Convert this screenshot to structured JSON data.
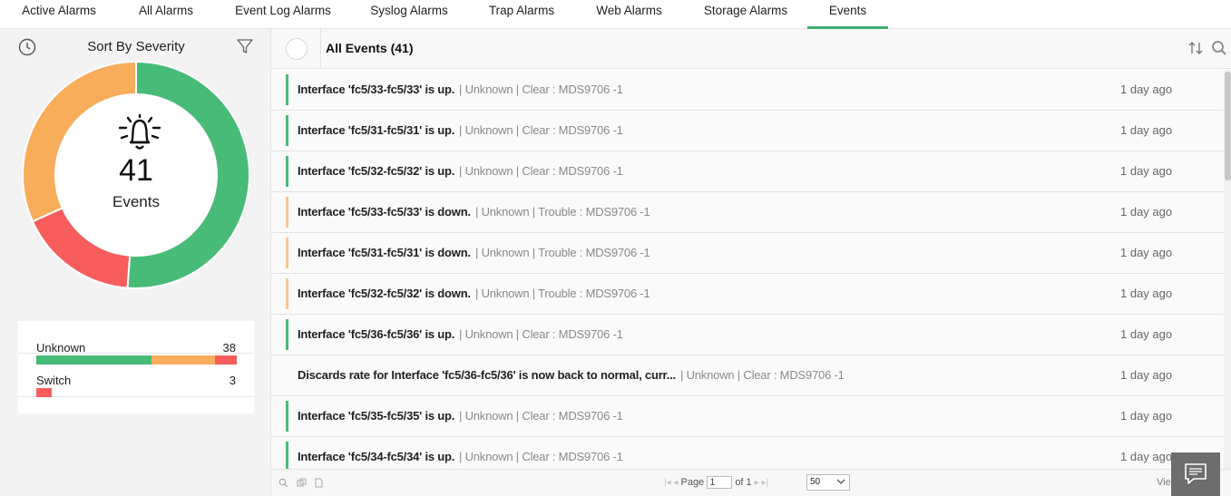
{
  "tabs": [
    {
      "label": "Active Alarms",
      "active": false
    },
    {
      "label": "All Alarms",
      "active": false
    },
    {
      "label": "Event Log Alarms",
      "active": false
    },
    {
      "label": "Syslog Alarms",
      "active": false
    },
    {
      "label": "Trap Alarms",
      "active": false
    },
    {
      "label": "Web Alarms",
      "active": false
    },
    {
      "label": "Storage Alarms",
      "active": false
    },
    {
      "label": "Events",
      "active": true
    }
  ],
  "left_panel": {
    "sort_title": "Sort By Severity",
    "total_count": "41",
    "total_label": "Events",
    "icons": [
      "clock-icon",
      "filter-icon",
      "bell-icon"
    ],
    "donut": {
      "segments": [
        {
          "severity": "Clear",
          "value": 21,
          "color": "#48bb78"
        },
        {
          "severity": "Critical",
          "value": 7,
          "color": "#f75d5d"
        },
        {
          "severity": "Trouble",
          "value": 13,
          "color": "#f8ad5b"
        }
      ]
    },
    "categories": [
      {
        "name": "Unknown",
        "count": "38",
        "bar": [
          {
            "severity": "Clear",
            "fraction": 0.53,
            "color": "#48bb78"
          },
          {
            "severity": "Trouble",
            "fraction": 0.29,
            "color": "#f8ad5b"
          },
          {
            "severity": "Critical",
            "fraction": 0.1,
            "color": "#f75d5d"
          }
        ]
      },
      {
        "name": "Switch",
        "count": "3",
        "bar": [
          {
            "severity": "Critical",
            "fraction": 0.07,
            "color": "#f75d5d"
          }
        ]
      }
    ]
  },
  "events": {
    "title": "All Events (41)",
    "icons": [
      "sort-icon",
      "search-icon"
    ],
    "rows": [
      {
        "message": "Interface 'fc5/33-fc5/33' is up.",
        "meta": "| Unknown | Clear : MDS9706 -1",
        "time": "1 day ago",
        "severity": "clear"
      },
      {
        "message": "Interface 'fc5/31-fc5/31' is up.",
        "meta": "| Unknown | Clear : MDS9706 -1",
        "time": "1 day ago",
        "severity": "clear"
      },
      {
        "message": "Interface 'fc5/32-fc5/32' is up.",
        "meta": "| Unknown | Clear : MDS9706 -1",
        "time": "1 day ago",
        "severity": "clear"
      },
      {
        "message": "Interface 'fc5/33-fc5/33' is down.",
        "meta": "| Unknown | Trouble : MDS9706 -1",
        "time": "1 day ago",
        "severity": "trouble"
      },
      {
        "message": "Interface 'fc5/31-fc5/31' is down.",
        "meta": "| Unknown | Trouble : MDS9706 -1",
        "time": "1 day ago",
        "severity": "trouble"
      },
      {
        "message": "Interface 'fc5/32-fc5/32' is down.",
        "meta": "| Unknown | Trouble : MDS9706 -1",
        "time": "1 day ago",
        "severity": "trouble"
      },
      {
        "message": "Interface 'fc5/36-fc5/36' is up.",
        "meta": "| Unknown | Clear : MDS9706 -1",
        "time": "1 day ago",
        "severity": "clear"
      },
      {
        "message": "Discards rate for Interface 'fc5/36-fc5/36' is now back to normal, curr...",
        "meta": "| Unknown | Clear : MDS9706 -1",
        "time": "1 day ago",
        "severity": "none"
      },
      {
        "message": "Interface 'fc5/35-fc5/35' is up.",
        "meta": "| Unknown | Clear : MDS9706 -1",
        "time": "1 day ago",
        "severity": "clear"
      },
      {
        "message": "Interface 'fc5/34-fc5/34' is up.",
        "meta": "| Unknown | Clear : MDS9706 -1",
        "time": "1 day ago",
        "severity": "clear"
      }
    ],
    "severity_colors": {
      "clear": "#48bb78",
      "trouble": "#f8c98f",
      "critical": "#f75d5d",
      "none": "transparent"
    }
  },
  "footer": {
    "page_label": "Page",
    "page_value": "1",
    "of_label": "of 1",
    "per_page": "50",
    "view_text": "Vie",
    "icons": [
      "search-small-icon",
      "copy-icon",
      "document-icon",
      "chevron-down-icon"
    ]
  },
  "chat_button": {
    "icon": "chat-icon"
  }
}
